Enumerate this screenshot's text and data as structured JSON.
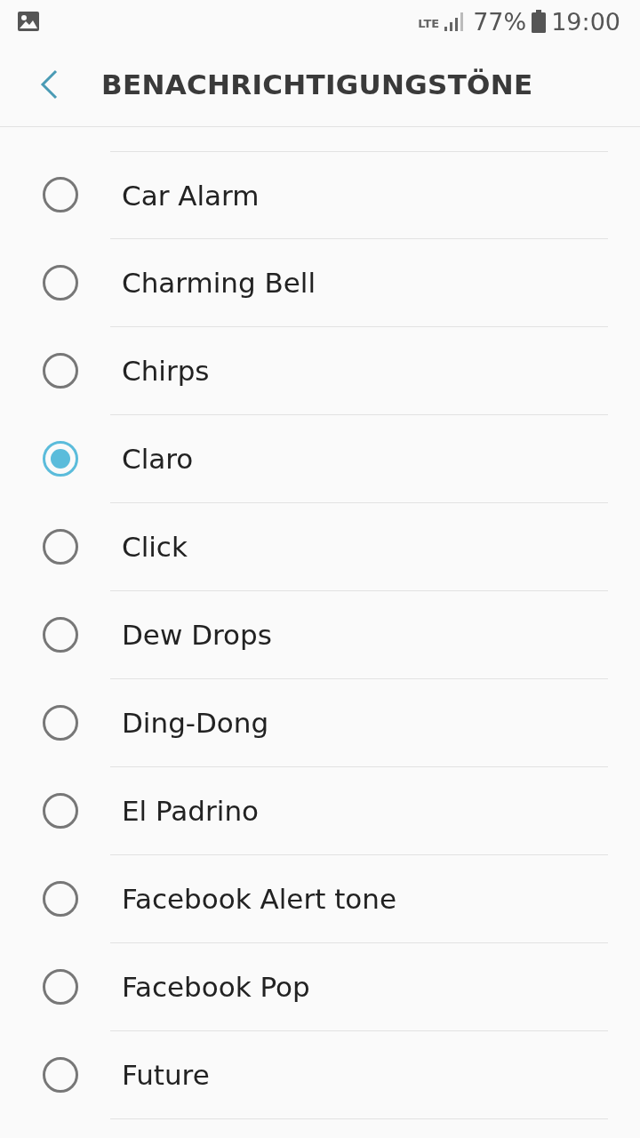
{
  "status_bar": {
    "network": "LTE",
    "battery": "77%",
    "time": "19:00"
  },
  "header": {
    "title": "BENACHRICHTIGUNGSTÖNE"
  },
  "tones": [
    {
      "label": "Car Alarm",
      "selected": false
    },
    {
      "label": "Charming Bell",
      "selected": false
    },
    {
      "label": "Chirps",
      "selected": false
    },
    {
      "label": "Claro",
      "selected": true
    },
    {
      "label": "Click",
      "selected": false
    },
    {
      "label": "Dew Drops",
      "selected": false
    },
    {
      "label": "Ding-Dong",
      "selected": false
    },
    {
      "label": "El Padrino",
      "selected": false
    },
    {
      "label": "Facebook Alert tone",
      "selected": false
    },
    {
      "label": "Facebook Pop",
      "selected": false
    },
    {
      "label": "Future",
      "selected": false
    }
  ]
}
